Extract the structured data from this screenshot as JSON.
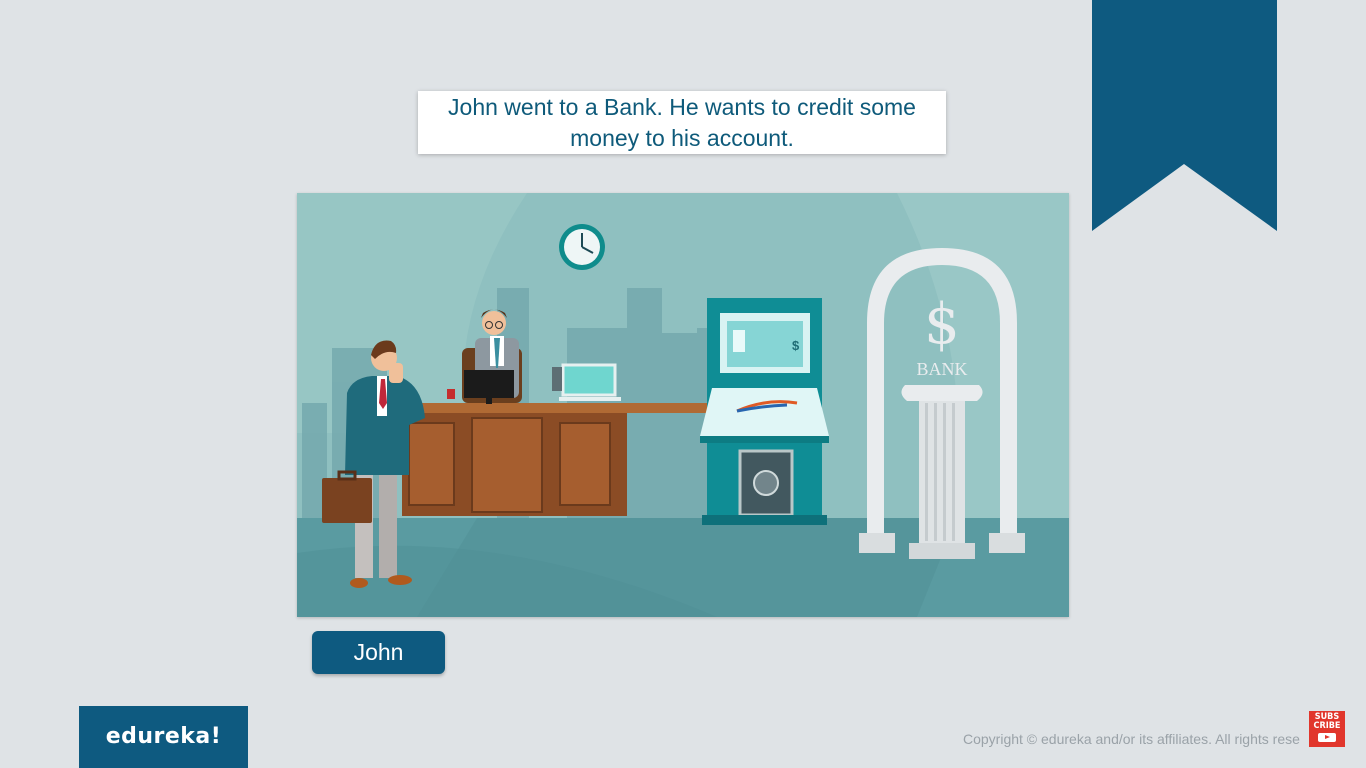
{
  "caption": {
    "line1": "John went to a Bank. He wants to credit some",
    "line2": "money to his account."
  },
  "scene": {
    "bank_sign": "BANK",
    "dollar_symbol": "$",
    "atm_screen_symbol": "$"
  },
  "name_button": {
    "label": "John"
  },
  "footer": {
    "logo": "edureka!",
    "copyright": "Copyright © edureka and/or its affiliates. All rights rese",
    "subscribe_line1": "SUBS",
    "subscribe_line2": "CRIBE"
  },
  "colors": {
    "brand_blue": "#0e5a80",
    "background": "#dfe3e6",
    "scene_teal": "#7fb3b5",
    "subscribe_red": "#e1362c"
  },
  "icons": [
    "bookmark-ribbon",
    "clock-icon",
    "youtube-icon"
  ]
}
